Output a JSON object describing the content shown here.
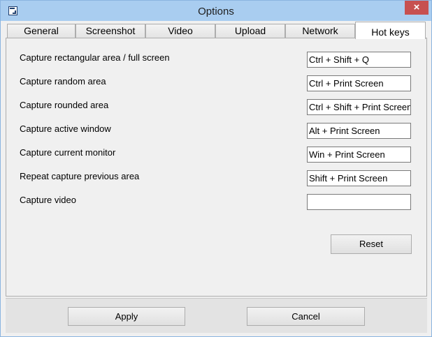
{
  "window": {
    "title": "Options",
    "close_glyph": "×",
    "app_icon": "app-logo-icon",
    "close_icon": "close-icon"
  },
  "tabs": [
    {
      "label": "General"
    },
    {
      "label": "Screenshot"
    },
    {
      "label": "Video"
    },
    {
      "label": "Upload"
    },
    {
      "label": "Network"
    },
    {
      "label": "Hot keys",
      "active": true
    }
  ],
  "hotkeys": [
    {
      "label": "Capture rectangular area / full screen",
      "value": "Ctrl + Shift + Q"
    },
    {
      "label": "Capture random area",
      "value": "Ctrl + Print Screen"
    },
    {
      "label": "Capture rounded area",
      "value": "Ctrl + Shift + Print Screen"
    },
    {
      "label": "Capture active window",
      "value": "Alt + Print Screen"
    },
    {
      "label": "Capture current monitor",
      "value": "Win + Print Screen"
    },
    {
      "label": "Repeat capture previous area",
      "value": "Shift + Print Screen"
    },
    {
      "label": "Capture video",
      "value": ""
    }
  ],
  "buttons": {
    "reset": "Reset",
    "apply": "Apply",
    "cancel": "Cancel"
  },
  "colors": {
    "titlebar": "#a9cdf0",
    "close_button": "#c75050"
  }
}
